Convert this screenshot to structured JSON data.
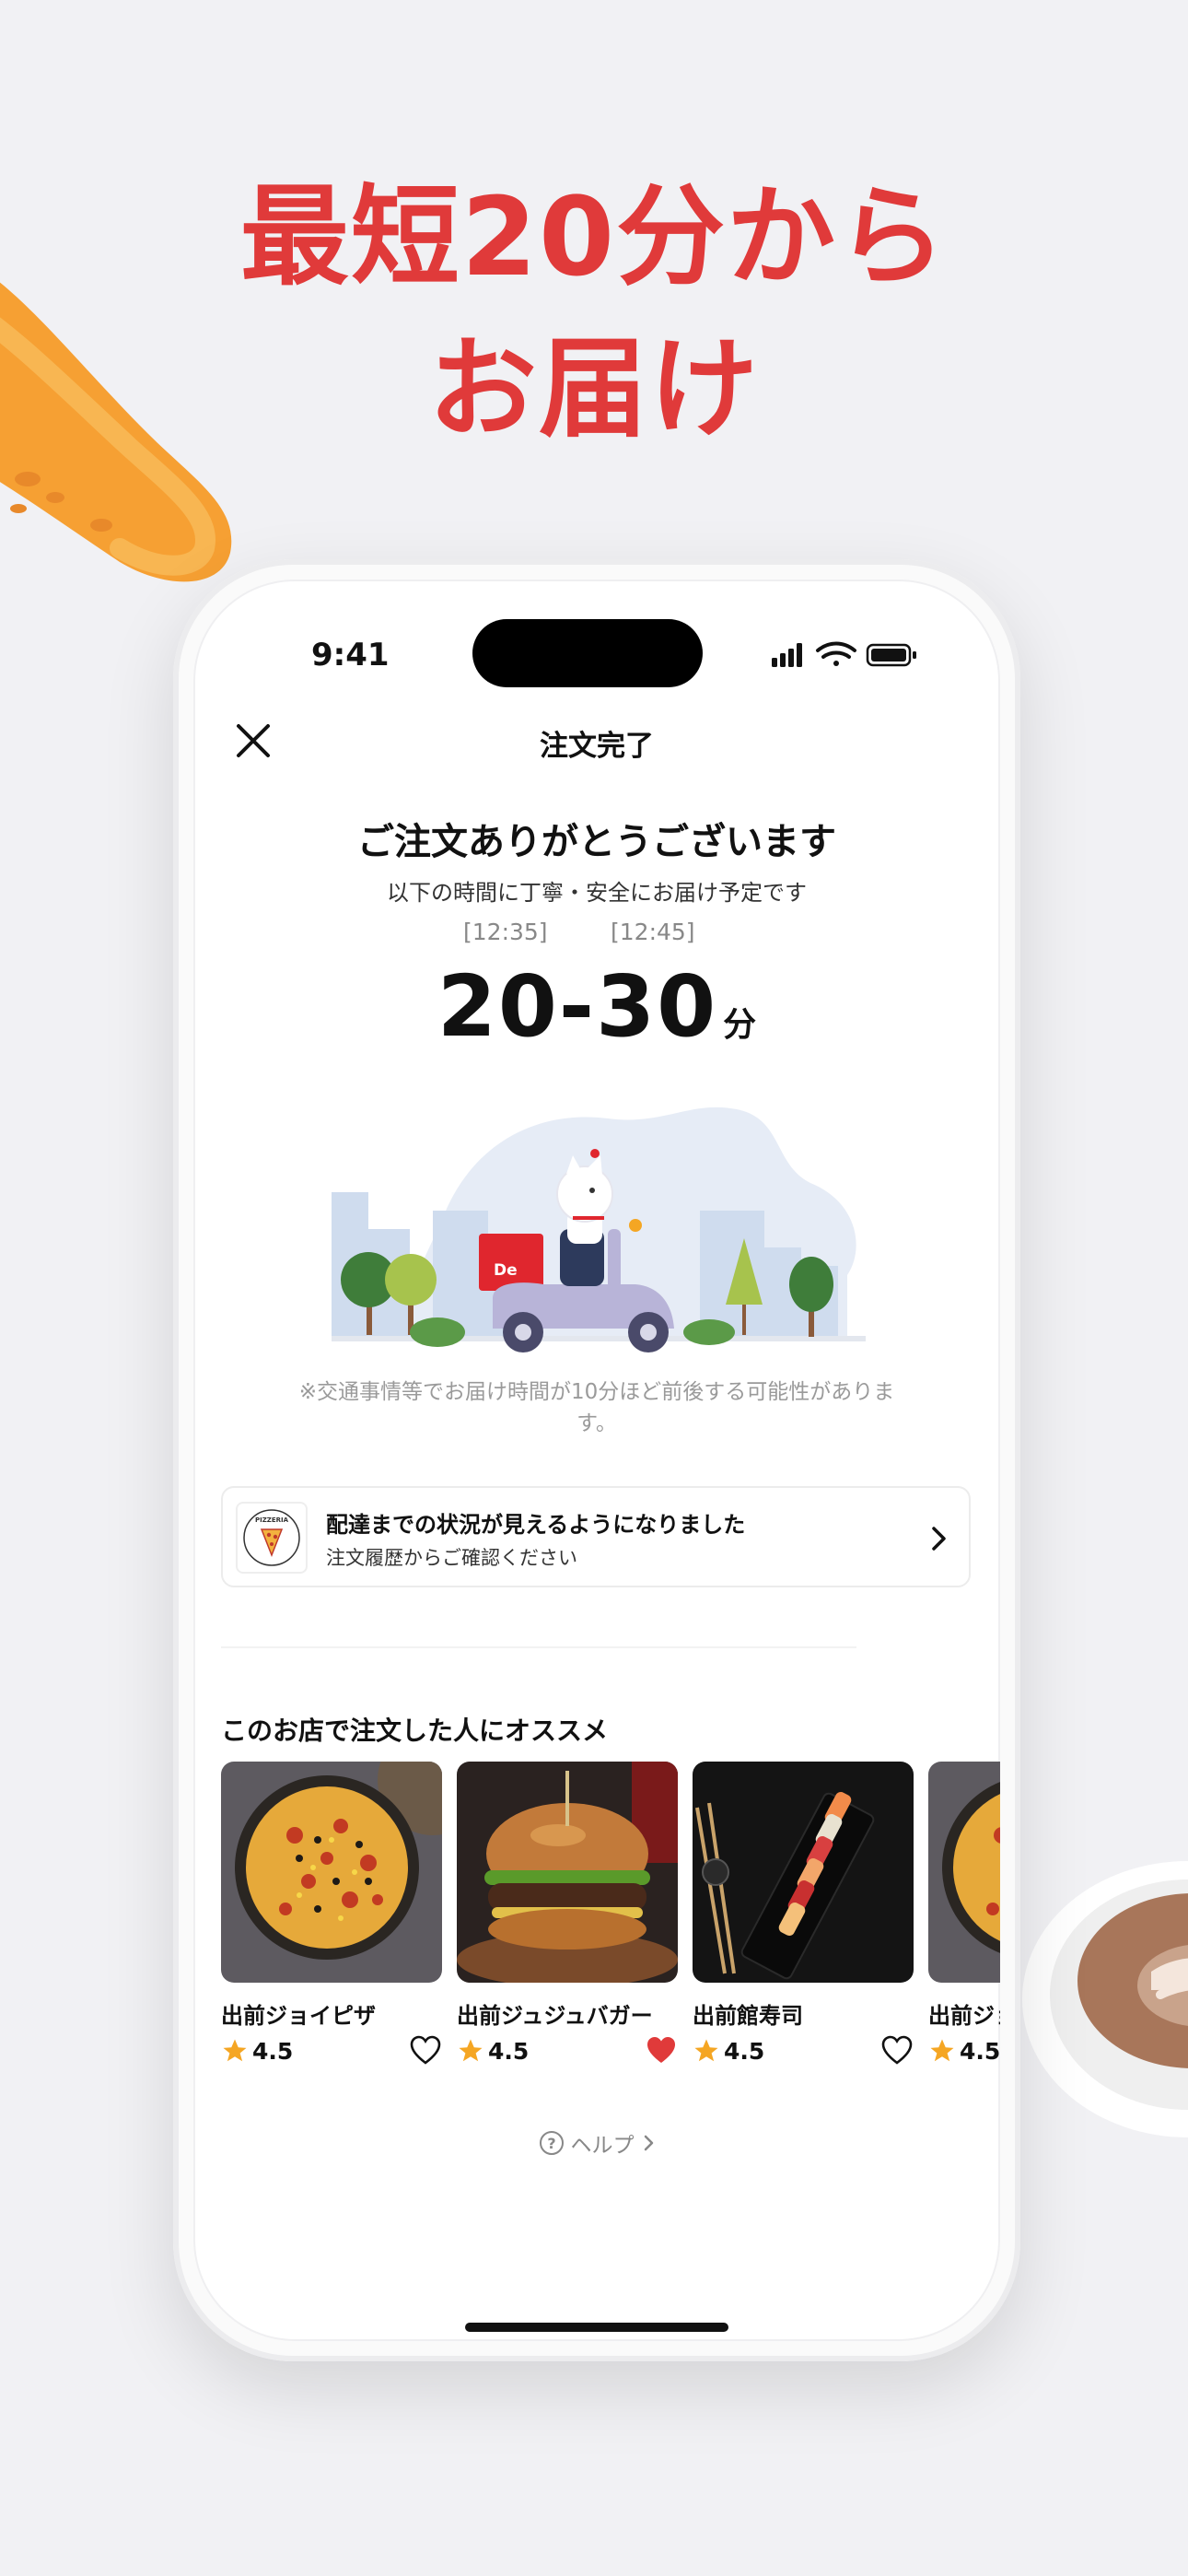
{
  "headline": {
    "line1": "最短20分から",
    "line2": "お届け"
  },
  "status_bar": {
    "time": "9:41"
  },
  "nav": {
    "title": "注文完了"
  },
  "confirmation": {
    "heading": "ご注文ありがとうございます",
    "subheading": "以下の時間に丁寧・安全にお届け予定です",
    "time_from": "[12:35]",
    "time_to": "[12:45]",
    "eta_text": "20-30",
    "eta_unit": "分",
    "note": "※交通事情等でお届け時間が10分ほど前後する可能性があります。",
    "scooter_label": "De"
  },
  "status_card": {
    "title": "配達までの状況が見えるようになりました",
    "subtitle": "注文履歴からご確認ください",
    "logo_text": "PIZZERIA"
  },
  "recommend": {
    "title": "このお店で注文した人にオススメ",
    "items": [
      {
        "name": "出前ジョイピザ",
        "rating": "4.5",
        "favorited": false,
        "image": "pizza"
      },
      {
        "name": "出前ジュジュバガー",
        "rating": "4.5",
        "favorited": true,
        "image": "burger"
      },
      {
        "name": "出前館寿司",
        "rating": "4.5",
        "favorited": false,
        "image": "sushi"
      },
      {
        "name": "出前ジョ",
        "rating": "4.5",
        "favorited": false,
        "image": "pizza"
      }
    ]
  },
  "help": {
    "label": "ヘルプ"
  },
  "colors": {
    "brand_red": "#e03a3a",
    "star": "#f5a623",
    "heart": "#e03a3a"
  }
}
